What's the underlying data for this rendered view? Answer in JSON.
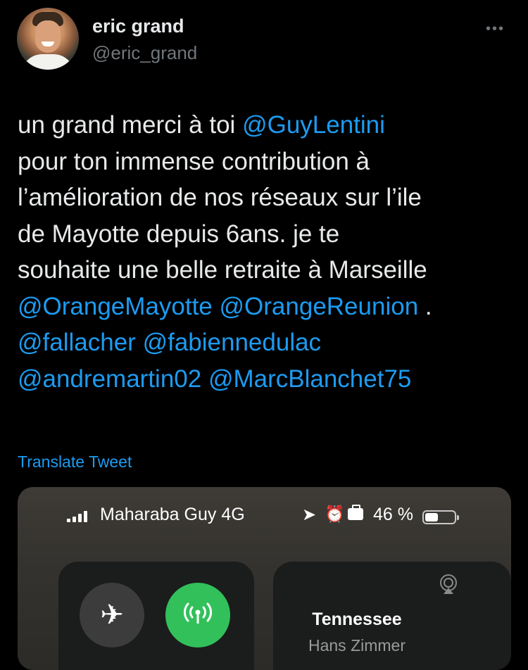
{
  "author": {
    "name": "eric grand",
    "handle": "@eric_grand"
  },
  "more_icon": "more-horizontal-icon",
  "tweet": {
    "segments": [
      {
        "text": "un grand merci à toi ",
        "type": "text"
      },
      {
        "text": "@GuyLentini",
        "type": "mention"
      },
      {
        "text": "\npour ton immense contribution à\nl’amélioration de nos réseaux sur l’ile\nde Mayotte depuis 6ans. je te\nsouhaite une belle retraite à Marseille\n",
        "type": "text"
      },
      {
        "text": "@OrangeMayotte",
        "type": "mention"
      },
      {
        "text": " ",
        "type": "text"
      },
      {
        "text": "@OrangeReunion",
        "type": "mention"
      },
      {
        "text": " .\n",
        "type": "text"
      },
      {
        "text": "@fallacher",
        "type": "mention"
      },
      {
        "text": " ",
        "type": "text"
      },
      {
        "text": "@fabiennedulac",
        "type": "mention"
      },
      {
        "text": "\n",
        "type": "text"
      },
      {
        "text": "@andremartin02",
        "type": "mention"
      },
      {
        "text": " ",
        "type": "text"
      },
      {
        "text": "@MarcBlanchet75",
        "type": "mention"
      }
    ]
  },
  "translate_label": "Translate Tweet",
  "screenshot": {
    "status_bar": {
      "carrier": "Maharaba Guy 4G",
      "battery_text": "46 %",
      "battery_level": 0.46,
      "icons": [
        "signal-icon",
        "location-arrow-icon",
        "alarm-icon",
        "briefcase-icon",
        "battery-icon"
      ]
    },
    "connectivity": {
      "airplane_icon": "airplane-icon",
      "cellular_icon": "cellular-antenna-icon",
      "cellular_color": "#32c05a"
    },
    "music": {
      "title": "Tennessee",
      "artist": "Hans Zimmer",
      "airplay_icon": "airplay-audio-icon"
    }
  },
  "colors": {
    "background": "#000000",
    "text": "#e7e9ea",
    "secondary": "#71767b",
    "link": "#1d9bf0"
  }
}
